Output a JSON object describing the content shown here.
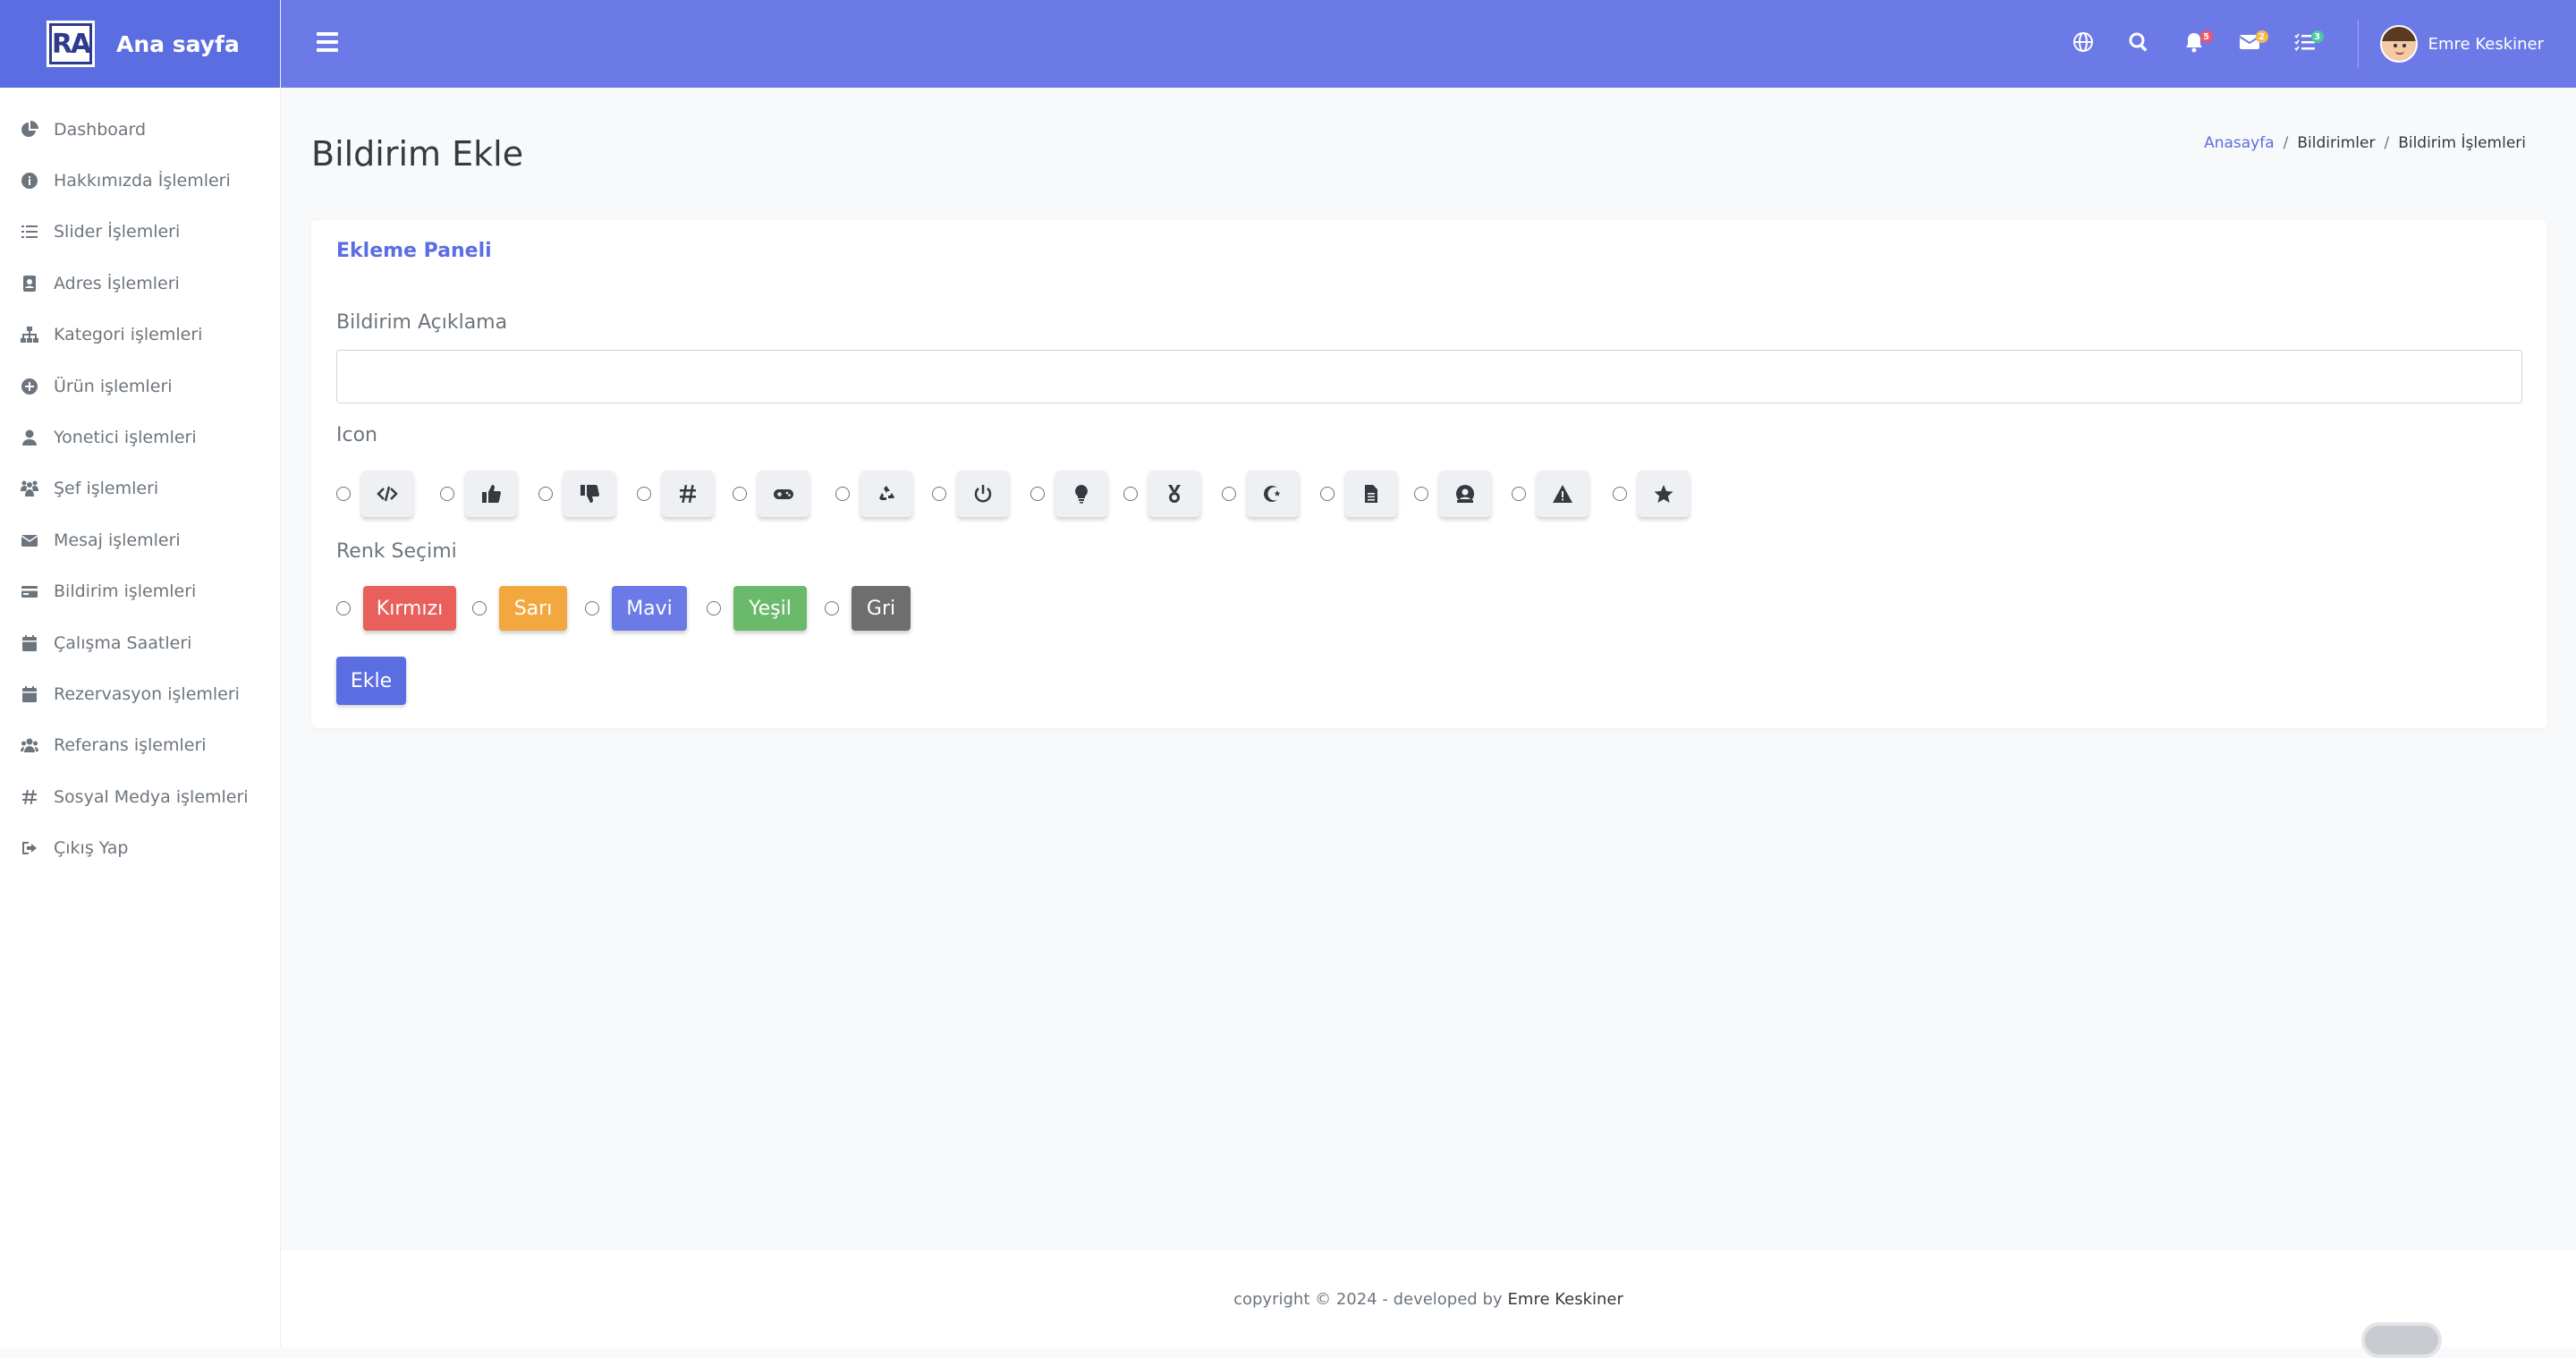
{
  "brand": {
    "logo_text": "RA",
    "title": "Ana sayfa"
  },
  "sidebar": {
    "items": [
      {
        "label": "Dashboard",
        "icon": "chart-pie-icon"
      },
      {
        "label": "Hakkımızda İşlemleri",
        "icon": "info-icon"
      },
      {
        "label": "Slider İşlemleri",
        "icon": "list-icon"
      },
      {
        "label": "Adres İşlemleri",
        "icon": "address-book-icon"
      },
      {
        "label": "Kategori işlemleri",
        "icon": "sitemap-icon"
      },
      {
        "label": "Ürün işlemleri",
        "icon": "plus-circle-icon"
      },
      {
        "label": "Yonetici işlemleri",
        "icon": "user-icon"
      },
      {
        "label": "Şef işlemleri",
        "icon": "chef-team-icon"
      },
      {
        "label": "Mesaj işlemleri",
        "icon": "envelope-icon"
      },
      {
        "label": "Bildirim işlemleri",
        "icon": "credit-card-icon"
      },
      {
        "label": "Çalışma Saatleri",
        "icon": "calendar-icon"
      },
      {
        "label": "Rezervasyon işlemleri",
        "icon": "calendar-icon"
      },
      {
        "label": "Referans işlemleri",
        "icon": "users-icon"
      },
      {
        "label": "Sosyal Medya işlemleri",
        "icon": "hashtag-icon"
      },
      {
        "label": "Çıkış Yap",
        "icon": "sign-out-icon"
      }
    ]
  },
  "topbar": {
    "notifications_count": "5",
    "messages_count": "2",
    "tasks_count": "3",
    "user_name": "Emre Keskiner"
  },
  "page": {
    "title": "Bildirim Ekle",
    "breadcrumb": [
      "Anasayfa",
      "Bildirimler",
      "Bildirim İşlemleri"
    ]
  },
  "form": {
    "panel_title": "Ekleme Paneli",
    "description_label": "Bildirim Açıklama",
    "description_value": "",
    "icon_label": "Icon",
    "icons": [
      "code-icon",
      "thumbs-up-icon",
      "thumbs-down-icon",
      "hashtag-icon",
      "gamepad-icon",
      "recycle-icon",
      "power-icon",
      "lightbulb-icon",
      "medal-icon",
      "star-and-crescent-icon",
      "file-icon",
      "user-circle-icon",
      "warning-icon",
      "star-icon"
    ],
    "color_label": "Renk Seçimi",
    "colors": [
      {
        "label": "Kırmızı",
        "hex": "#e95f5b"
      },
      {
        "label": "Sarı",
        "hex": "#f3a73f"
      },
      {
        "label": "Mavi",
        "hex": "#6c7ae7"
      },
      {
        "label": "Yeşil",
        "hex": "#6bb96b"
      },
      {
        "label": "Gri",
        "hex": "#6e6e6e"
      }
    ],
    "submit_label": "Ekle"
  },
  "footer": {
    "text": "copyright © 2024 - developed by",
    "author": "Emre Keskiner"
  }
}
